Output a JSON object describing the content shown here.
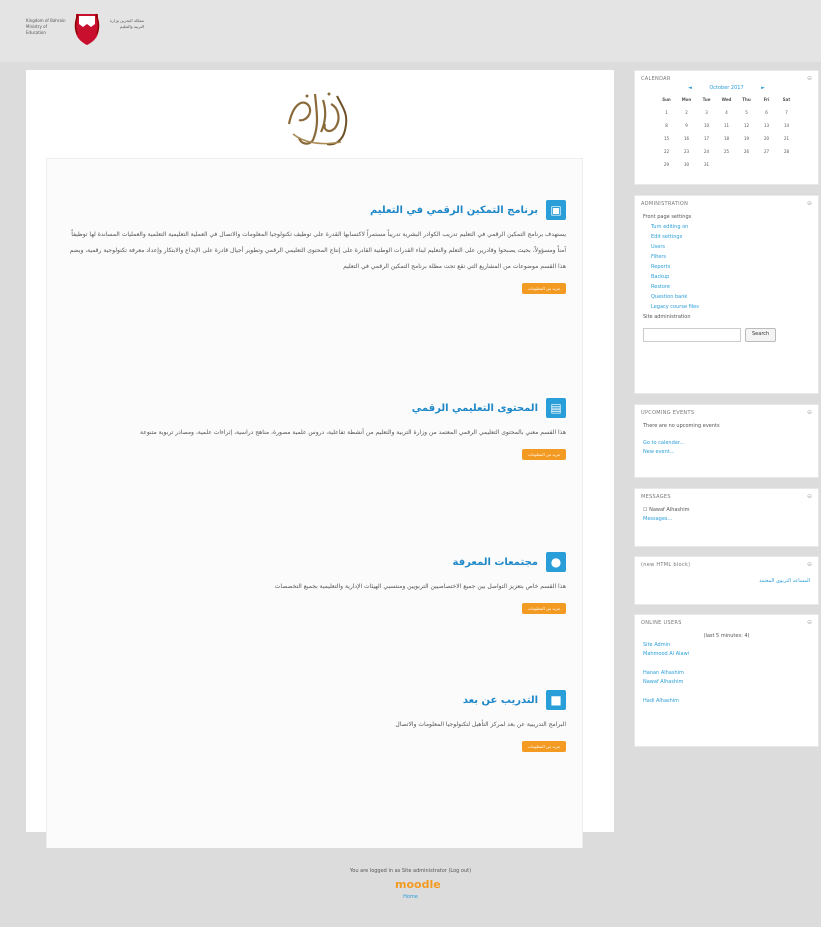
{
  "header": {
    "ministry_en": "Kingdom of Bahrain Ministry of Education",
    "ministry_ar": "مملكة البحرين وزارة التربية والتعليم"
  },
  "logo": {
    "calligraphy": "الملتقى التربوي"
  },
  "sections": [
    {
      "icon": "screen-icon",
      "title": "برنامج التمكين الرقمي في التعليم",
      "desc": "يستهدف برنامج التمكين الرقمي في التعليم تدريب الكوادر البشرية تدريباً مستمراً لاكتسابها القدرة على توظيف تكنولوجيا المعلومات والاتصال في العملية التعليمية التعلمية والعمليات المساندة لها توظيفاً آمناً ومسؤولاً، بحيث يصبحوا وقادرين على التعلم والتعليم لبناء القدرات الوطنية القادرة على إنتاج المحتوى التعليمي الرقمي وتطوير أجيال قادرة على الإبداع والابتكار وإعداد معرفة تكنولوجية رقمية، ويضم هذا القسم موضوعات من المشاريع التي تقع تحت مظلة برنامج التمكين الرقمي في التعليم",
      "button": "مزيد من المعلومات"
    },
    {
      "icon": "book-icon",
      "title": "المحتوى التعليمي الرقمي",
      "desc": "هذا القسم معني بالمحتوى التعليمي الرقمي المعتمد من وزارة التربية والتعليم من أنشطة تفاعلية، دروس علمية مصورة، مناهج دراسية، إثراءات علمية، ومصادر تربوية متنوعة",
      "button": "مزيد من المعلومات"
    },
    {
      "icon": "community-icon",
      "title": "مجتمعات المعرفة",
      "desc": "هذا القسم خاص بتعزيز التواصل بين جميع الاختصاصيين التربويين ومنتسبي الهيئات الإدارية والتعليمية بجميع التخصصات",
      "button": "مزيد من المعلومات"
    },
    {
      "icon": "briefcase-icon",
      "title": "التدريب عن بعد",
      "desc": "البرامج التدريبية عن بعد لمركز التأهيل لتكنولوجيا المعلومات والاتصال",
      "button": "مزيد من المعلومات"
    }
  ],
  "calendar": {
    "title": "CALENDAR",
    "month": "October 2017",
    "days": [
      "Sun",
      "Mon",
      "Tue",
      "Wed",
      "Thu",
      "Fri",
      "Sat"
    ],
    "weeks": [
      [
        "1",
        "2",
        "3",
        "4",
        "5",
        "6",
        "7"
      ],
      [
        "8",
        "9",
        "10",
        "11",
        "12",
        "13",
        "14"
      ],
      [
        "15",
        "16",
        "17",
        "18",
        "19",
        "20",
        "21"
      ],
      [
        "22",
        "23",
        "24",
        "25",
        "26",
        "27",
        "28"
      ],
      [
        "29",
        "30",
        "31",
        "",
        "",
        "",
        ""
      ]
    ]
  },
  "administration": {
    "title": "ADMINISTRATION",
    "items": [
      "Front page settings",
      "Turn editing on",
      "Edit settings",
      "Users",
      "Filters",
      "Reports",
      "Backup",
      "Restore",
      "Question bank",
      "Legacy course files",
      "Site administration"
    ],
    "search_button": "Search"
  },
  "upcoming": {
    "title": "UPCOMING EVENTS",
    "text": "There are no upcoming events",
    "links": [
      "Go to calendar...",
      "New event..."
    ]
  },
  "messages": {
    "title": "MESSAGES",
    "user": "Nawaf Alhashim",
    "link": "Messages..."
  },
  "newblock": {
    "title": "(new HTML block)",
    "link": "المساعد التربوي المعتمد"
  },
  "online": {
    "title": "ONLINE USERS",
    "summary": "(last 5 minutes: 4)",
    "users": [
      "Site Admin",
      "Mahmood Al Alawi",
      "Hanan Alhashim",
      "Nawaf Alhashim",
      "Hadi Alhashim"
    ]
  },
  "footer": {
    "logged_in": "You are logged in as Site administrator (Log out)",
    "moodle": "moodle",
    "home": "Home"
  }
}
